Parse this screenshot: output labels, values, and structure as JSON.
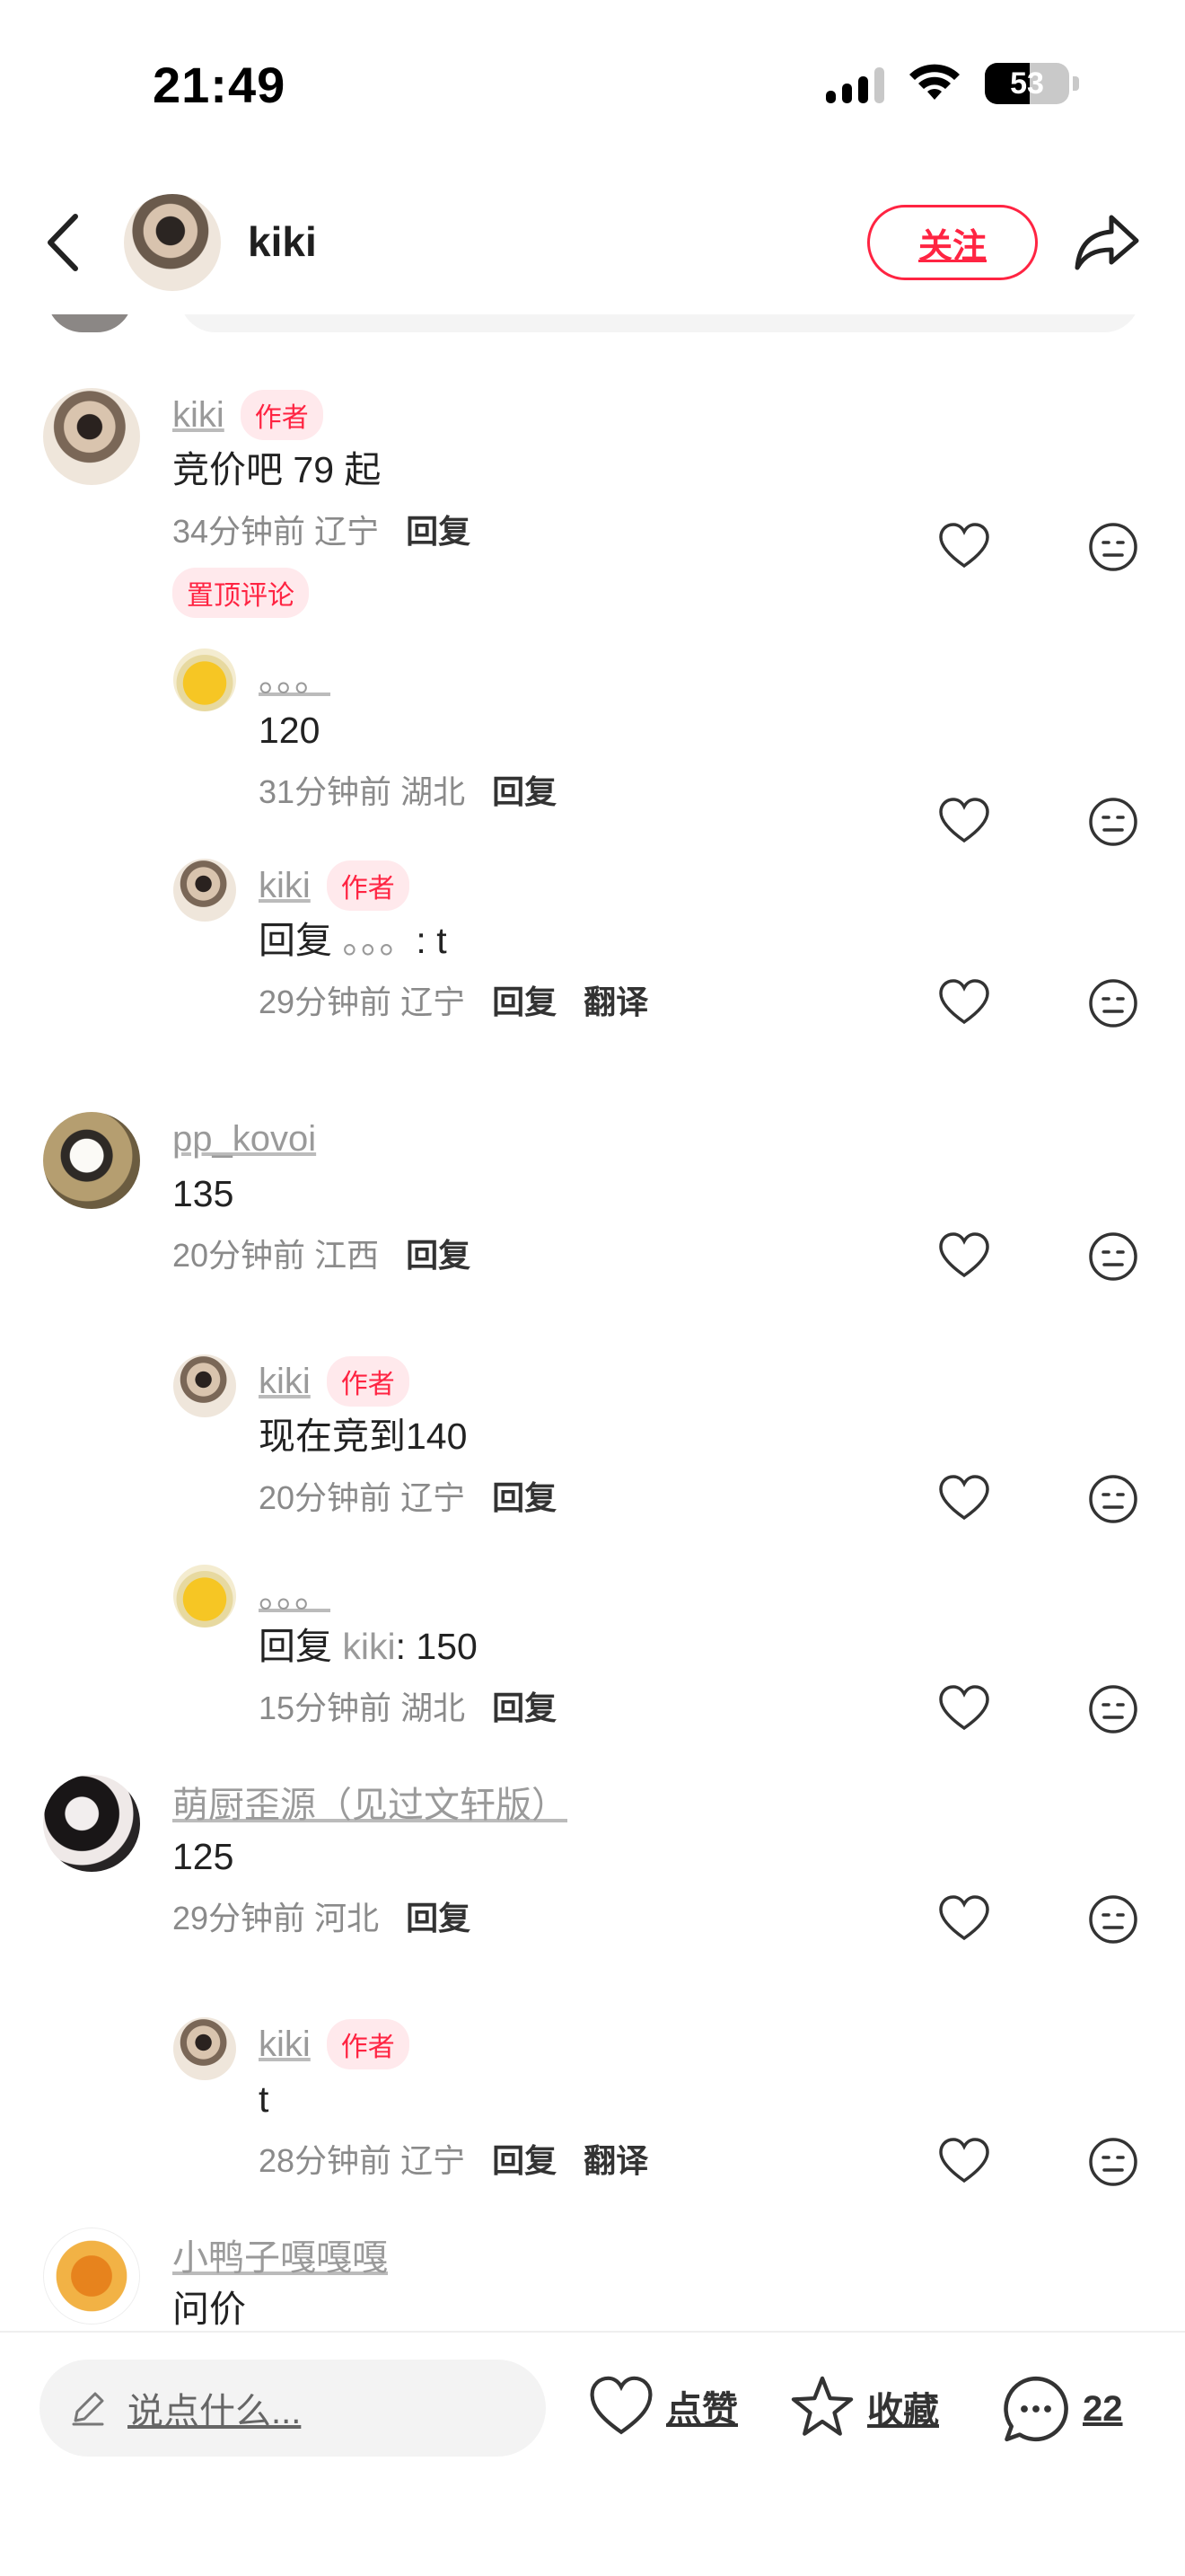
{
  "status_bar": {
    "time": "21:49",
    "battery": "53",
    "battery_fraction": 0.53
  },
  "nav": {
    "author_name": "kiki",
    "follow_label": "关注"
  },
  "author_tag": "作者",
  "comments": [
    {
      "user": "kiki",
      "is_author": true,
      "text": "竞价吧 79 起",
      "time": "34分钟前",
      "location": "辽宁",
      "reply_label": "回复",
      "pinned": "置顶评论",
      "replies": [
        {
          "user": "。。。",
          "text": "120",
          "time": "31分钟前",
          "location": "湖北",
          "reply_label": "回复"
        },
        {
          "user": "kiki",
          "is_author": true,
          "text_prefix": "回复 ",
          "reply_to": "。。。",
          "text": ": t",
          "time": "29分钟前",
          "location": "辽宁",
          "reply_label": "回复",
          "translate_label": "翻译"
        }
      ]
    },
    {
      "user": "pp_kovoi",
      "text": "135",
      "time": "20分钟前",
      "location": "江西",
      "reply_label": "回复",
      "replies": [
        {
          "user": "kiki",
          "is_author": true,
          "text": "现在竞到140",
          "time": "20分钟前",
          "location": "辽宁",
          "reply_label": "回复"
        },
        {
          "user": "。。。",
          "text_prefix": "回复 ",
          "reply_to": "kiki",
          "text": ": 150",
          "time": "15分钟前",
          "location": "湖北",
          "reply_label": "回复"
        }
      ]
    },
    {
      "user": "萌厨歪源（见过文轩版）",
      "text": "125",
      "time": "29分钟前",
      "location": "河北",
      "reply_label": "回复",
      "replies": [
        {
          "user": "kiki",
          "is_author": true,
          "text": "t",
          "time": "28分钟前",
          "location": "辽宁",
          "reply_label": "回复",
          "translate_label": "翻译"
        }
      ]
    },
    {
      "user": "小鸭子嘎嘎嘎",
      "text": "问价"
    }
  ],
  "bottom_bar": {
    "input_placeholder": "说点什么...",
    "like_label": "点赞",
    "collect_label": "收藏",
    "comment_count": "22"
  },
  "colors": {
    "accent": "#ff2442",
    "tag_bg": "#ffe9ec",
    "muted": "#9a9a9a"
  }
}
